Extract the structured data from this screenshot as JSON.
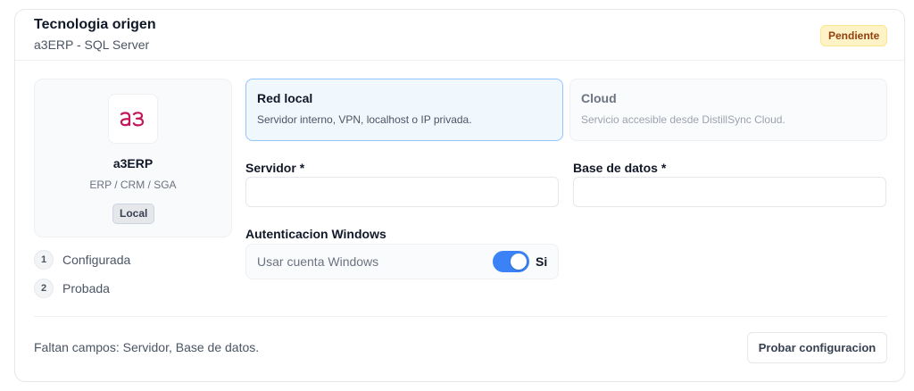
{
  "header": {
    "title": "Tecnologia origen",
    "subtitle": "a3ERP - SQL Server",
    "status_badge": "Pendiente"
  },
  "product": {
    "logo_text": "a3",
    "logo_color": "#c2185b",
    "name": "a3ERP",
    "category": "ERP / CRM / SGA",
    "mode_badge": "Local"
  },
  "steps": [
    {
      "number": "1",
      "label": "Configurada"
    },
    {
      "number": "2",
      "label": "Probada"
    }
  ],
  "connection_options": [
    {
      "title": "Red local",
      "description": "Servidor interno, VPN, localhost o IP privada.",
      "selected": true
    },
    {
      "title": "Cloud",
      "description": "Servicio accesible desde DistillSync Cloud.",
      "selected": false
    }
  ],
  "fields": {
    "server": {
      "label": "Servidor *",
      "value": "",
      "placeholder": ""
    },
    "database": {
      "label": "Base de datos *",
      "value": "",
      "placeholder": ""
    }
  },
  "windows_auth": {
    "label": "Autenticacion Windows",
    "toggle_text": "Usar cuenta Windows",
    "toggle_state": "Si",
    "enabled": true,
    "accent": "#3b82f6"
  },
  "footer": {
    "message": "Faltan campos: Servidor, Base de datos.",
    "test_button": "Probar configuracion"
  }
}
